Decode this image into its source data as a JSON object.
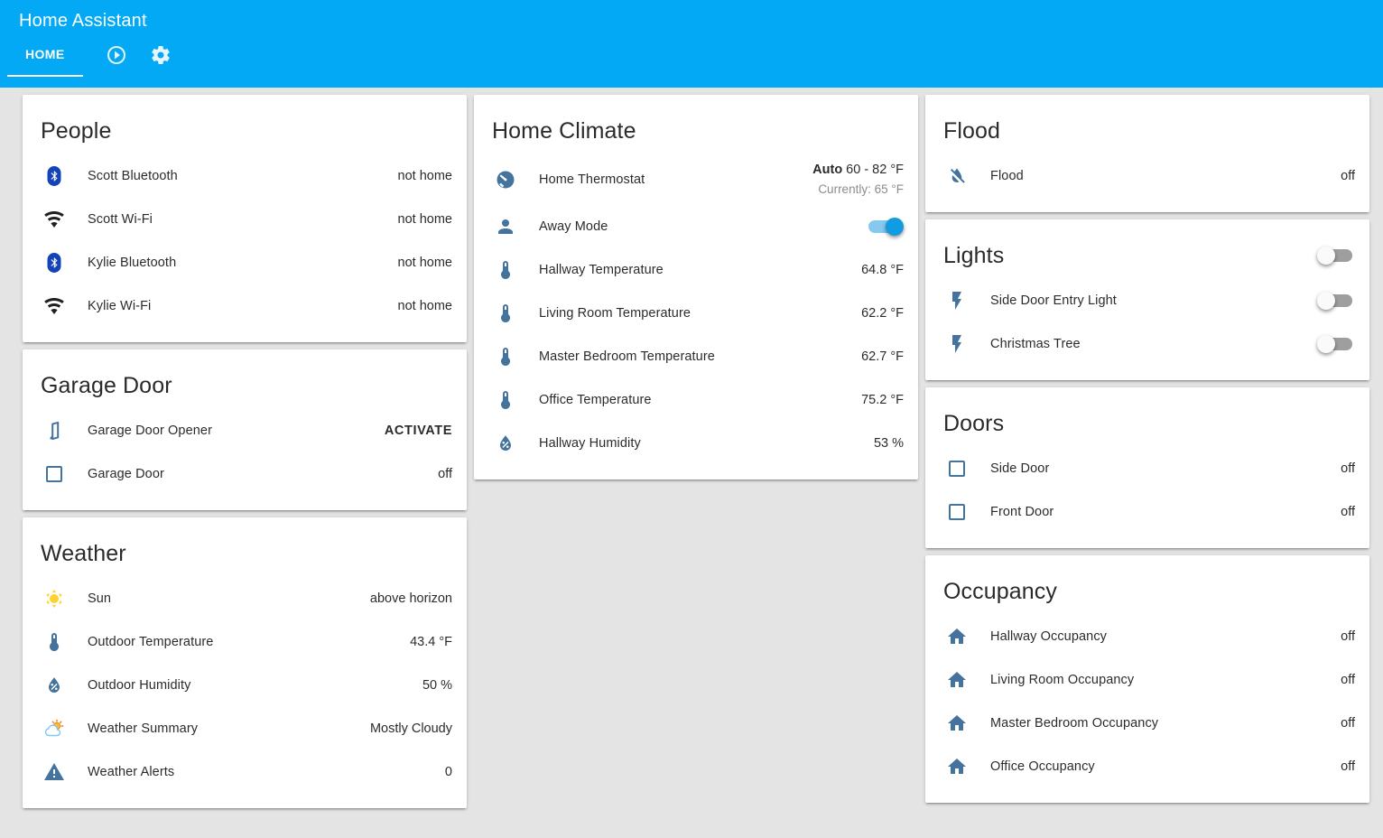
{
  "app": {
    "title": "Home Assistant",
    "tabs": [
      {
        "label": "HOME"
      }
    ],
    "toolbar_icons": [
      "play-circle-icon",
      "settings-icon"
    ]
  },
  "colors": {
    "header_bg": "#03a9f4",
    "accent_link": "#03a9f4",
    "state_icon": "#44739e",
    "wifi_icon": "#212121",
    "bluetooth_badge": "#1442b8",
    "sun_icon": "#fdd231",
    "toggle_on_knob": "#119be0",
    "toggle_on_track": "#85c9ee",
    "secondary_text": "#8c8c8c"
  },
  "columns": [
    {
      "cards": [
        {
          "title": "People",
          "rows": [
            {
              "icon": "bluetooth",
              "name": "Scott Bluetooth",
              "value": "not home"
            },
            {
              "icon": "wifi",
              "name": "Scott Wi-Fi",
              "value": "not home"
            },
            {
              "icon": "bluetooth",
              "name": "Kylie Bluetooth",
              "value": "not home"
            },
            {
              "icon": "wifi",
              "name": "Kylie Wi-Fi",
              "value": "not home"
            }
          ]
        },
        {
          "title": "Garage Door",
          "rows": [
            {
              "icon": "door-open",
              "name": "Garage Door Opener",
              "action": "ACTIVATE"
            },
            {
              "icon": "checkbox-blank-outline",
              "name": "Garage Door",
              "value": "off"
            }
          ]
        },
        {
          "title": "Weather",
          "rows": [
            {
              "icon": "sun",
              "name": "Sun",
              "value": "above horizon"
            },
            {
              "icon": "thermometer",
              "name": "Outdoor Temperature",
              "value": "43.4 °F"
            },
            {
              "icon": "water-percent",
              "name": "Outdoor Humidity",
              "value": "50 %"
            },
            {
              "icon": "partly-cloudy",
              "name": "Weather Summary",
              "value": "Mostly Cloudy"
            },
            {
              "icon": "alert",
              "name": "Weather Alerts",
              "value": "0"
            }
          ]
        }
      ]
    },
    {
      "cards": [
        {
          "title": "Home Climate",
          "rows": [
            {
              "icon": "thermostat",
              "name": "Home Thermostat",
              "mode": "Auto",
              "range": "60 - 82 °F",
              "currently": "Currently: 65 °F"
            },
            {
              "icon": "account",
              "name": "Away Mode",
              "toggle": "on"
            },
            {
              "icon": "thermometer",
              "name": "Hallway Temperature",
              "value": "64.8 °F"
            },
            {
              "icon": "thermometer",
              "name": "Living Room Temperature",
              "value": "62.2 °F"
            },
            {
              "icon": "thermometer",
              "name": "Master Bedroom Temperature",
              "value": "62.7 °F"
            },
            {
              "icon": "thermometer",
              "name": "Office Temperature",
              "value": "75.2 °F"
            },
            {
              "icon": "water-percent",
              "name": "Hallway Humidity",
              "value": "53 %"
            }
          ]
        }
      ]
    },
    {
      "cards": [
        {
          "title": "Flood",
          "rows": [
            {
              "icon": "water-off",
              "name": "Flood",
              "value": "off"
            }
          ]
        },
        {
          "title": "Lights",
          "header_toggle": "off",
          "rows": [
            {
              "icon": "flash",
              "name": "Side Door Entry Light",
              "toggle": "off"
            },
            {
              "icon": "flash",
              "name": "Christmas Tree",
              "toggle": "off"
            }
          ]
        },
        {
          "title": "Doors",
          "rows": [
            {
              "icon": "checkbox-blank-outline",
              "name": "Side Door",
              "value": "off"
            },
            {
              "icon": "checkbox-blank-outline",
              "name": "Front Door",
              "value": "off"
            }
          ]
        },
        {
          "title": "Occupancy",
          "rows": [
            {
              "icon": "home",
              "name": "Hallway Occupancy",
              "value": "off"
            },
            {
              "icon": "home",
              "name": "Living Room Occupancy",
              "value": "off"
            },
            {
              "icon": "home",
              "name": "Master Bedroom Occupancy",
              "value": "off"
            },
            {
              "icon": "home",
              "name": "Office Occupancy",
              "value": "off"
            }
          ]
        }
      ]
    }
  ]
}
